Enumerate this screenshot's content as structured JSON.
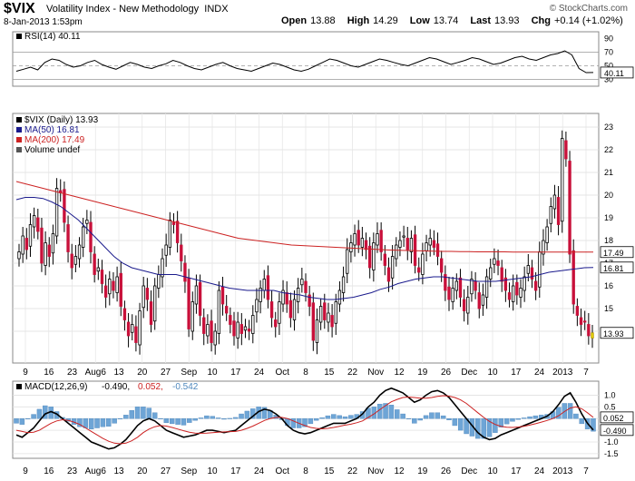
{
  "header": {
    "symbol": "$VIX",
    "name": "Volatility Index - New Methodology",
    "exchange": "INDX",
    "date": "8-Jan-2013 1:53pm",
    "copyright": "© StockCharts.com",
    "quote": {
      "open_label": "Open",
      "open": "13.88",
      "high_label": "High",
      "high": "14.29",
      "low_label": "Low",
      "low": "13.74",
      "last_label": "Last",
      "last": "13.93",
      "chg_label": "Chg",
      "chg": "+0.14 (+1.02%)"
    }
  },
  "chart_data": [
    {
      "type": "line",
      "panel": "rsi",
      "legend": "RSI(14) 40.11",
      "ylim": [
        20,
        100
      ],
      "yticks": [
        30,
        50,
        70,
        90
      ],
      "reference_lines": [
        30,
        50,
        70
      ],
      "last_value_label": "40.11",
      "color": "#000000",
      "values": [
        42,
        45,
        48,
        44,
        55,
        60,
        58,
        52,
        48,
        50,
        55,
        58,
        52,
        48,
        45,
        50,
        55,
        52,
        48,
        46,
        50,
        53,
        58,
        55,
        50,
        46,
        44,
        48,
        52,
        55,
        50,
        46,
        44,
        42,
        46,
        50,
        54,
        52,
        48,
        44,
        42,
        45,
        50,
        55,
        60,
        58,
        54,
        50,
        48,
        52,
        56,
        60,
        58,
        55,
        52,
        50,
        54,
        58,
        62,
        60,
        56,
        52,
        55,
        58,
        62,
        60,
        56,
        52,
        54,
        58,
        62,
        64,
        60,
        58,
        62,
        66,
        68,
        72,
        66,
        46,
        40,
        40.11
      ]
    },
    {
      "type": "candlestick",
      "panel": "price",
      "legend": [
        "$VIX (Daily) 13.93",
        "MA(50) 16.81",
        "MA(200) 17.49",
        "Volume undef"
      ],
      "ylim": [
        12.6,
        23.6
      ],
      "yticks": [
        14,
        15,
        16,
        17,
        18,
        19,
        20,
        21,
        22,
        23
      ],
      "last_price_label": "13.93",
      "ma50_label": "16.81",
      "ma200_label": "17.49",
      "xlabels": [
        "9",
        "16",
        "23",
        "Aug6",
        "13",
        "20",
        "27",
        "Sep",
        "10",
        "17",
        "24",
        "Oct",
        "8",
        "15",
        "22",
        "Nov",
        "12",
        "19",
        "26",
        "Dec",
        "10",
        "17",
        "24",
        "2013",
        "7"
      ],
      "close": [
        17.5,
        18.2,
        17.6,
        18.7,
        19.1,
        18.4,
        17.0,
        17.9,
        17.3,
        18.3,
        20.3,
        20.1,
        18.8,
        17.5,
        16.8,
        17.3,
        17.8,
        18.6,
        18.9,
        17.5,
        16.5,
        16.8,
        16.1,
        15.5,
        16.3,
        15.8,
        16.4,
        15.1,
        14.5,
        13.8,
        14.3,
        13.5,
        14.9,
        16.0,
        15.4,
        14.3,
        16.0,
        16.5,
        17.2,
        17.8,
        18.9,
        18.7,
        17.9,
        17.1,
        16.2,
        14.1,
        15.3,
        16.0,
        14.7,
        13.9,
        14.3,
        13.5,
        14.0,
        15.8,
        15.2,
        14.8,
        14.3,
        13.8,
        14.4,
        13.9,
        14.2,
        14.0,
        14.7,
        15.4,
        15.9,
        16.3,
        15.4,
        14.6,
        14.2,
        15.3,
        15.8,
        15.2,
        14.6,
        15.4,
        15.9,
        16.3,
        15.7,
        15.1,
        13.6,
        14.5,
        15.1,
        14.5,
        14.8,
        14.2,
        15.3,
        15.8,
        16.4,
        17.6,
        17.9,
        18.3,
        17.8,
        18.1,
        17.6,
        16.8,
        17.9,
        18.3,
        17.5,
        16.9,
        16.2,
        17.3,
        17.8,
        18.0,
        18.2,
        17.6,
        18.1,
        16.9,
        16.6,
        17.4,
        17.9,
        18.1,
        17.7,
        17.3,
        16.6,
        15.8,
        15.4,
        15.9,
        16.2,
        15.5,
        14.9,
        15.5,
        16.3,
        15.8,
        15.0,
        15.6,
        16.4,
        16.8,
        17.2,
        16.9,
        16.2,
        15.8,
        15.4,
        16.0,
        15.6,
        15.9,
        16.4,
        16.9,
        16.3,
        15.8,
        17.5,
        18.0,
        18.6,
        19.5,
        20.0,
        18.7,
        22.5,
        21.6,
        17.4,
        15.2,
        14.7,
        14.3,
        14.4,
        13.8,
        13.93
      ]
    },
    {
      "type": "line",
      "panel": "price-ma",
      "series": [
        {
          "name": "MA(50)",
          "color": "#1a1a8c",
          "values": [
            19.8,
            19.9,
            19.9,
            19.85,
            19.7,
            19.5,
            19.2,
            18.9,
            18.5,
            18.1,
            17.7,
            17.3,
            17.0,
            16.8,
            16.7,
            16.6,
            16.5,
            16.5,
            16.5,
            16.4,
            16.3,
            16.2,
            16.1,
            16.0,
            15.9,
            15.85,
            15.8,
            15.8,
            15.8,
            15.8,
            15.7,
            15.65,
            15.6,
            15.5,
            15.45,
            15.4,
            15.4,
            15.45,
            15.5,
            15.6,
            15.7,
            15.85,
            15.95,
            16.1,
            16.2,
            16.3,
            16.35,
            16.4,
            16.4,
            16.35,
            16.3,
            16.25,
            16.2,
            16.2,
            16.2,
            16.25,
            16.3,
            16.35,
            16.4,
            16.5,
            16.6,
            16.65,
            16.7,
            16.75,
            16.8,
            16.81
          ]
        },
        {
          "name": "MA(200)",
          "color": "#cc2222",
          "values": [
            20.6,
            20.5,
            20.4,
            20.3,
            20.2,
            20.1,
            20.0,
            19.9,
            19.8,
            19.7,
            19.6,
            19.5,
            19.4,
            19.3,
            19.2,
            19.1,
            19.0,
            18.9,
            18.8,
            18.7,
            18.6,
            18.5,
            18.4,
            18.3,
            18.2,
            18.1,
            18.05,
            18.0,
            17.95,
            17.9,
            17.85,
            17.8,
            17.78,
            17.76,
            17.74,
            17.72,
            17.7,
            17.68,
            17.66,
            17.64,
            17.62,
            17.6,
            17.58,
            17.57,
            17.56,
            17.55,
            17.54,
            17.53,
            17.52,
            17.52,
            17.51,
            17.51,
            17.5,
            17.5,
            17.5,
            17.5,
            17.49,
            17.49,
            17.49,
            17.49,
            17.49,
            17.49,
            17.49,
            17.49,
            17.49,
            17.49
          ]
        }
      ]
    },
    {
      "type": "line",
      "panel": "macd",
      "legend": {
        "label": "MACD(12,26,9)",
        "macd": "-0.490",
        "signal": "0.052",
        "hist": "-0.542"
      },
      "ylim": [
        -1.7,
        1.6
      ],
      "yticks": [
        "1.0",
        "0.5",
        "0.0",
        "-0.5",
        "-1.0",
        "-1.5"
      ],
      "macd_label": "-0.490",
      "signal_label": "0.052",
      "series": [
        {
          "name": "MACD",
          "color": "#000000",
          "values": [
            -0.7,
            -0.8,
            -0.6,
            -0.4,
            -0.1,
            0.2,
            0.3,
            0.2,
            0.0,
            -0.2,
            -0.4,
            -0.6,
            -0.8,
            -1.0,
            -1.1,
            -1.2,
            -1.3,
            -1.25,
            -1.1,
            -0.9,
            -0.6,
            -0.3,
            -0.1,
            0.0,
            -0.1,
            -0.3,
            -0.5,
            -0.6,
            -0.7,
            -0.8,
            -0.75,
            -0.7,
            -0.6,
            -0.5,
            -0.5,
            -0.55,
            -0.6,
            -0.55,
            -0.5,
            -0.3,
            -0.1,
            0.1,
            0.3,
            0.4,
            0.35,
            0.2,
            0.0,
            -0.3,
            -0.5,
            -0.6,
            -0.65,
            -0.6,
            -0.5,
            -0.4,
            -0.3,
            -0.2,
            -0.2,
            -0.2,
            -0.1,
            0.0,
            0.2,
            0.5,
            0.7,
            1.0,
            1.2,
            1.3,
            1.2,
            1.1,
            0.9,
            0.7,
            0.8,
            1.0,
            1.15,
            1.2,
            1.1,
            0.9,
            0.6,
            0.3,
            0.0,
            -0.3,
            -0.6,
            -0.8,
            -0.9,
            -0.85,
            -0.7,
            -0.6,
            -0.5,
            -0.4,
            -0.3,
            -0.2,
            -0.1,
            0.0,
            0.1,
            0.3,
            0.6,
            0.95,
            1.1,
            0.7,
            0.2,
            -0.2,
            -0.49
          ]
        },
        {
          "name": "Signal",
          "color": "#cc2222",
          "values": [
            -0.5,
            -0.55,
            -0.6,
            -0.58,
            -0.5,
            -0.35,
            -0.2,
            -0.1,
            -0.05,
            -0.08,
            -0.15,
            -0.25,
            -0.4,
            -0.55,
            -0.7,
            -0.85,
            -0.97,
            -1.05,
            -1.08,
            -1.05,
            -0.95,
            -0.8,
            -0.6,
            -0.45,
            -0.35,
            -0.3,
            -0.32,
            -0.38,
            -0.45,
            -0.52,
            -0.58,
            -0.62,
            -0.63,
            -0.62,
            -0.6,
            -0.58,
            -0.57,
            -0.56,
            -0.55,
            -0.5,
            -0.42,
            -0.32,
            -0.2,
            -0.08,
            0.0,
            0.05,
            0.05,
            0.0,
            -0.1,
            -0.2,
            -0.3,
            -0.38,
            -0.42,
            -0.44,
            -0.42,
            -0.38,
            -0.33,
            -0.28,
            -0.24,
            -0.18,
            -0.1,
            0.05,
            0.2,
            0.38,
            0.55,
            0.72,
            0.82,
            0.9,
            0.92,
            0.9,
            0.87,
            0.87,
            0.9,
            0.95,
            0.98,
            0.96,
            0.9,
            0.8,
            0.65,
            0.45,
            0.25,
            0.05,
            -0.12,
            -0.25,
            -0.33,
            -0.37,
            -0.38,
            -0.36,
            -0.33,
            -0.28,
            -0.22,
            -0.15,
            -0.08,
            0.0,
            0.12,
            0.3,
            0.45,
            0.5,
            0.42,
            0.25,
            0.052
          ]
        }
      ]
    }
  ]
}
